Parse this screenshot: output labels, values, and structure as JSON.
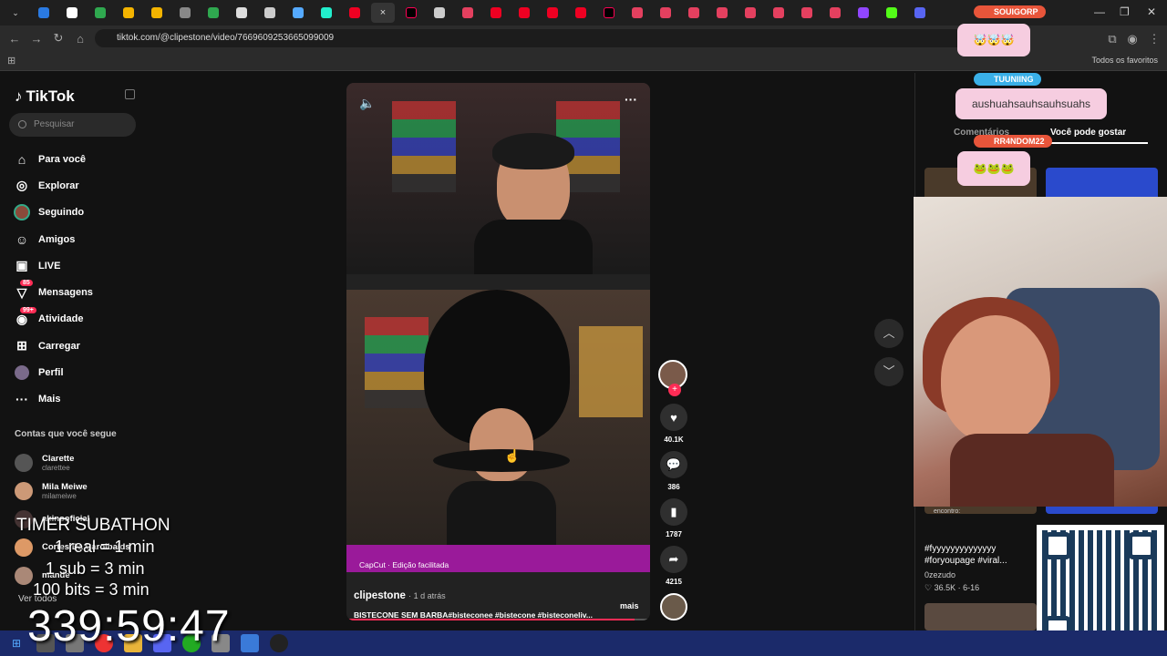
{
  "browser": {
    "url": "tiktok.com/@clipestone/video/7669609253665099009",
    "bookmarks_label": "Todos os favoritos",
    "active_tab_close": "×"
  },
  "sidebar": {
    "logo": "TikTok",
    "search_placeholder": "Pesquisar",
    "items": [
      {
        "label": "Para você",
        "icon": "home-icon",
        "glyph": "⌂"
      },
      {
        "label": "Explorar",
        "icon": "compass-icon",
        "glyph": "◎"
      },
      {
        "label": "Seguindo",
        "icon": "following-avatar-icon",
        "glyph": "●"
      },
      {
        "label": "Amigos",
        "icon": "friends-icon",
        "glyph": "☺"
      },
      {
        "label": "LIVE",
        "icon": "live-icon",
        "glyph": "▣"
      },
      {
        "label": "Mensagens",
        "icon": "messages-icon",
        "glyph": "▽",
        "badge": "85"
      },
      {
        "label": "Atividade",
        "icon": "activity-icon",
        "glyph": "◉",
        "badge": "99+"
      },
      {
        "label": "Carregar",
        "icon": "upload-icon",
        "glyph": "⊞"
      },
      {
        "label": "Perfil",
        "icon": "profile-icon",
        "glyph": "●"
      },
      {
        "label": "Mais",
        "icon": "more-icon",
        "glyph": "···"
      }
    ],
    "following_title": "Contas que você segue",
    "accounts": [
      {
        "name": "Clarette",
        "handle": "clarettee"
      },
      {
        "name": "Mila Meiwe",
        "handle": "milameiwe"
      },
      {
        "name": "akinooficial",
        "handle": ""
      },
      {
        "name": "Cortes Da Carolbalds",
        "handle": ""
      },
      {
        "name": "mande",
        "handle": ""
      }
    ],
    "see_all": "Ver todos"
  },
  "video": {
    "capcut": "CapCut · Edição facilitada",
    "author": "clipestone",
    "time_ago": "· 1 d atrás",
    "caption": "BISTECONE SEM BARBA#bistеconee #bistecone #bisteconeliv...",
    "more": "mais",
    "progress": 0.95
  },
  "actions": {
    "likes": "40.1K",
    "comments": "386",
    "saves": "1787",
    "shares": "4215"
  },
  "right_panel": {
    "tab_comments": "Comentários",
    "tab_you_may_like": "Você pode gostar",
    "card_text_1": "#fyyyyyyyyyyyyyy #foryoupage #viral...",
    "card_author": "0zezudo",
    "card_stats": "♡ 36.5K · 6-16",
    "card_small": "encontro:"
  },
  "overlay": {
    "chat_user_1": "SOUIGORP",
    "chat_user_2": "TUUNIING",
    "chat_message_2": "aushuahsauhsauhsuahs",
    "chat_user_3": "RR4NDOM22",
    "emotes_1": "🤯🤯🤯",
    "emotes_2": "🐸🐸🐸",
    "timer_title": "TIMER SUBATHON",
    "timer_lines": [
      "1 real = 1 min",
      "1 sub = 3 min",
      "100 bits = 3 min"
    ],
    "timer_value": "339:59:47"
  },
  "colors": {
    "accent": "#fe2c55",
    "taskbar": "#1b2a6a",
    "chat_pink": "#f6cde0"
  }
}
